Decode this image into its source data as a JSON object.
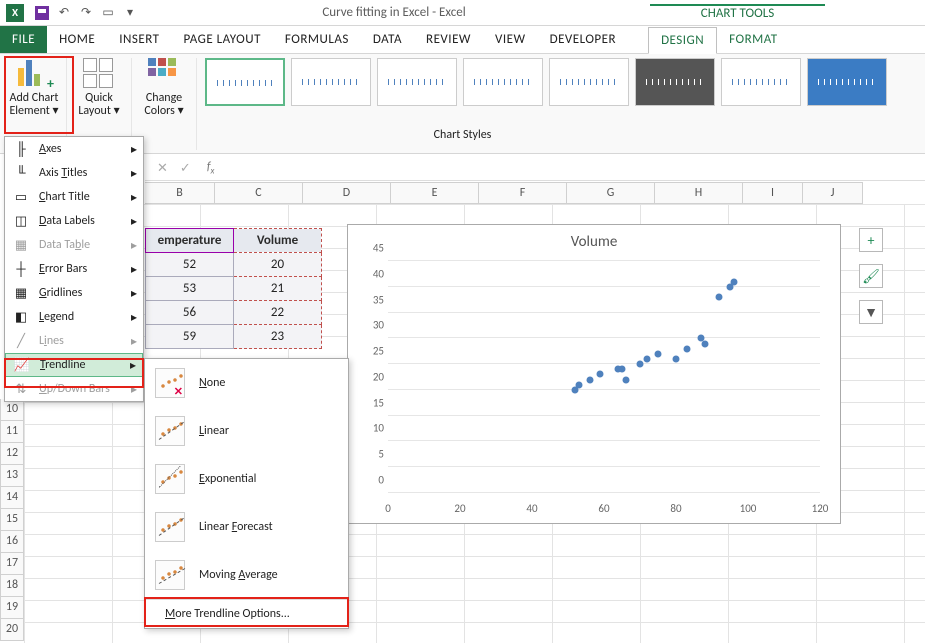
{
  "titlebar": {
    "title": "Curve fitting in Excel - Excel",
    "chart_tools": "CHART TOOLS",
    "excel_logo": "X"
  },
  "tabs": {
    "file": "FILE",
    "home": "HOME",
    "insert": "INSERT",
    "page_layout": "PAGE LAYOUT",
    "formulas": "FORMULAS",
    "data": "DATA",
    "review": "REVIEW",
    "view": "VIEW",
    "developer": "DEVELOPER",
    "design": "DESIGN",
    "format": "FORMAT"
  },
  "ribbon": {
    "add_chart_element": "Add Chart Element",
    "quick_layout": "Quick Layout",
    "change_colors": "Change Colors",
    "chart_styles": "Chart Styles"
  },
  "add_chart_menu": {
    "axes": "Axes",
    "axis_titles": "Axis Titles",
    "chart_title": "Chart Title",
    "data_labels": "Data Labels",
    "data_table": "Data Table",
    "error_bars": "Error Bars",
    "gridlines": "Gridlines",
    "legend": "Legend",
    "lines": "Lines",
    "trendline": "Trendline",
    "updown_bars": "Up/Down Bars"
  },
  "trendline_menu": {
    "none": "None",
    "linear": "Linear",
    "exponential": "Exponential",
    "linear_forecast": "Linear Forecast",
    "moving_average": "Moving Average",
    "more": "More Trendline Options..."
  },
  "columns": [
    "B",
    "C",
    "D",
    "E",
    "F",
    "G",
    "H",
    "I",
    "J"
  ],
  "row_headers": [
    "10",
    "11",
    "12",
    "13",
    "14",
    "15",
    "16",
    "17",
    "18",
    "19",
    "20"
  ],
  "table": {
    "header1": "emperature",
    "header2": "Volume",
    "rows": [
      {
        "t": "52",
        "v": "20"
      },
      {
        "t": "53",
        "v": "21"
      },
      {
        "t": "56",
        "v": "22"
      },
      {
        "t": "59",
        "v": "23"
      }
    ]
  },
  "formula_bar": {
    "cancel": "✕",
    "check": "✓",
    "fx": "fx"
  },
  "chart_side": {
    "add": "+",
    "brush": "🖌",
    "filter": "▼"
  },
  "chart_data": {
    "type": "scatter",
    "title": "Volume",
    "xlabel": "",
    "ylabel": "",
    "xlim": [
      0,
      120
    ],
    "xticks": [
      0,
      20,
      40,
      60,
      80,
      100,
      120
    ],
    "ylim": [
      0,
      45
    ],
    "yticks": [
      0,
      5,
      10,
      15,
      20,
      25,
      30,
      35,
      40,
      45
    ],
    "series": [
      {
        "name": "Volume",
        "x": [
          52,
          53,
          56,
          59,
          64,
          65,
          66,
          70,
          72,
          75,
          80,
          83,
          87,
          88,
          92,
          95,
          96
        ],
        "y": [
          20,
          21,
          22,
          23,
          24,
          24,
          22,
          25,
          26,
          27,
          26,
          28,
          30,
          29,
          38,
          40,
          41
        ]
      }
    ]
  }
}
